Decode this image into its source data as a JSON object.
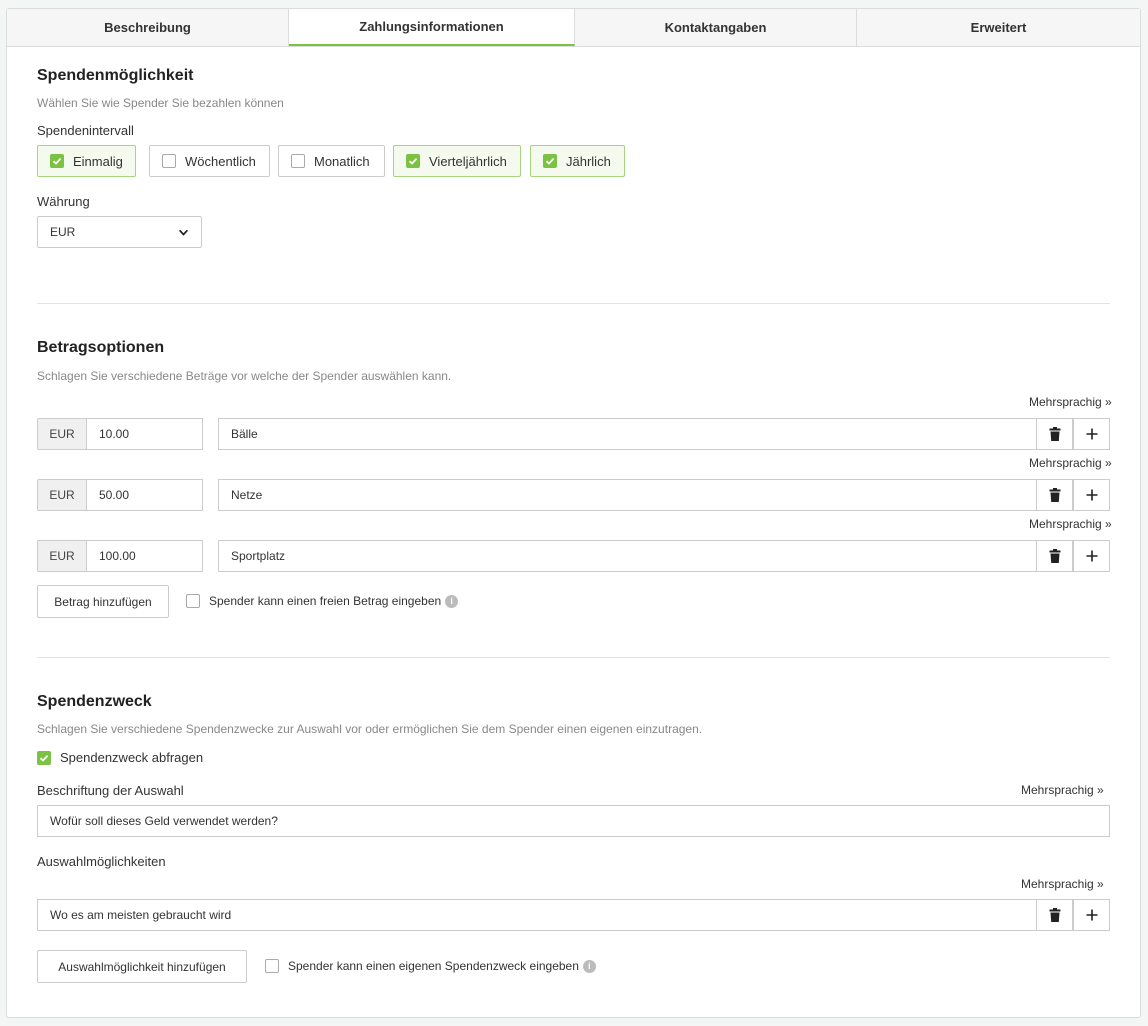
{
  "tabs": [
    "Beschreibung",
    "Zahlungsinformationen",
    "Kontaktangaben",
    "Erweitert"
  ],
  "payment": {
    "title": "Spendenmöglichkeit",
    "subtitle": "Wählen Sie wie Spender Sie bezahlen können",
    "interval_label": "Spendenintervall",
    "intervals": [
      {
        "label": "Einmalig",
        "checked": true
      },
      {
        "label": "Wöchentlich",
        "checked": false
      },
      {
        "label": "Monatlich",
        "checked": false
      },
      {
        "label": "Vierteljährlich",
        "checked": true
      },
      {
        "label": "Jährlich",
        "checked": true
      }
    ],
    "currency_label": "Währung",
    "currency_value": "EUR"
  },
  "amounts": {
    "title": "Betragsoptionen",
    "subtitle": "Schlagen Sie verschiedene Beträge vor welche der Spender auswählen kann.",
    "multilang": "Mehrsprachig »",
    "rows": [
      {
        "currency": "EUR",
        "amount": "10.00",
        "label": "Bälle"
      },
      {
        "currency": "EUR",
        "amount": "50.00",
        "label": "Netze"
      },
      {
        "currency": "EUR",
        "amount": "100.00",
        "label": "Sportplatz"
      }
    ],
    "add_button": "Betrag hinzufügen",
    "free_amount_label": "Spender kann einen freien Betrag eingeben",
    "free_amount_checked": false
  },
  "purpose": {
    "title": "Spendenzweck",
    "subtitle": "Schlagen Sie verschiedene Spendenzwecke zur Auswahl vor oder ermöglichen Sie dem Spender einen eigenen einzutragen.",
    "ask_label": "Spendenzweck abfragen",
    "ask_checked": true,
    "caption_label": "Beschriftung der Auswahl",
    "multilang": "Mehrsprachig »",
    "caption_value": "Wofür soll dieses Geld verwendet werden?",
    "options_label": "Auswahlmöglichkeiten",
    "options": [
      "Wo es am meisten gebraucht wird"
    ],
    "add_button": "Auswahlmöglichkeit hinzufügen",
    "own_purpose_label": "Spender kann einen eigenen Spendenzweck eingeben",
    "own_purpose_checked": false
  },
  "icons": {
    "check": "check-icon",
    "trash": "trash-icon",
    "plus": "plus-icon",
    "chevron": "chevron-down-icon",
    "info": "info-icon"
  },
  "colors": {
    "accent": "#7cc242"
  }
}
